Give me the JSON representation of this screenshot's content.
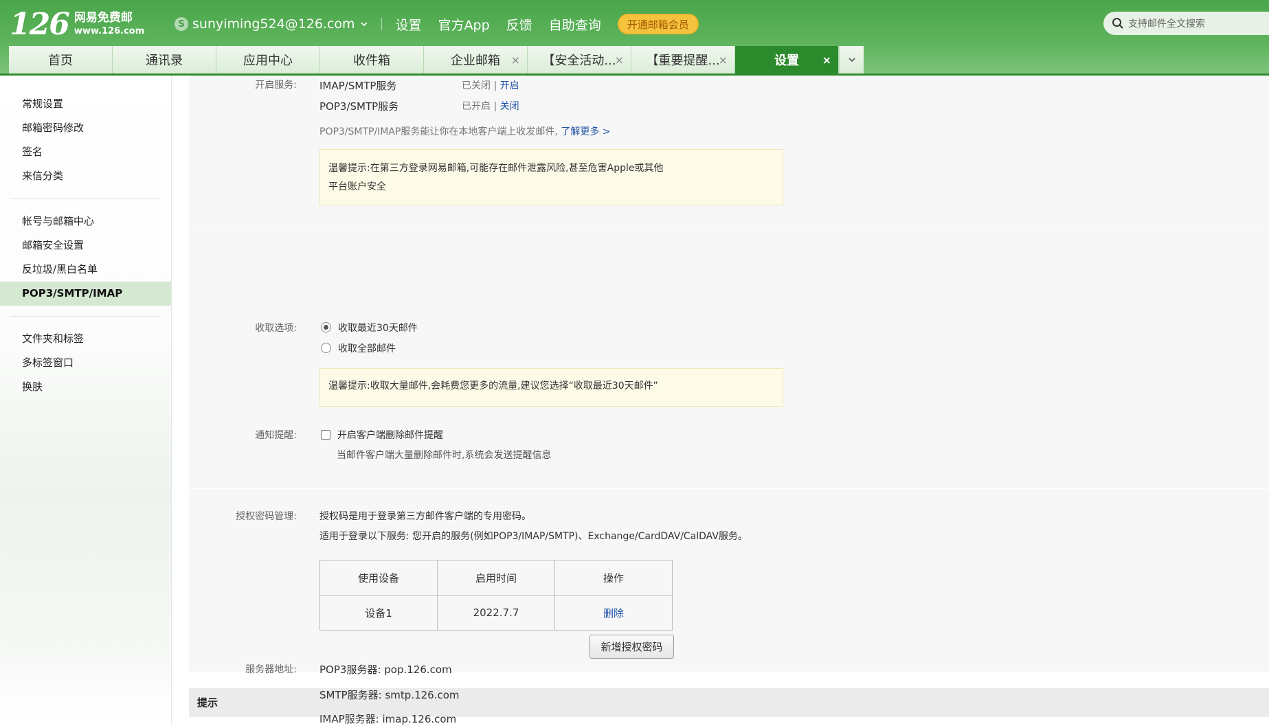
{
  "header": {
    "logo_number": "126",
    "logo_name": "网易免费邮",
    "logo_domain": "www.126.com",
    "account": "sunyiming524@126.com",
    "links": [
      "设置",
      "官方App",
      "反馈",
      "自助查询"
    ],
    "vip_label": "开通邮箱会员",
    "search_placeholder": "支持邮件全文搜索"
  },
  "tabs": [
    {
      "label": "首页",
      "closable": false
    },
    {
      "label": "通讯录",
      "closable": false
    },
    {
      "label": "应用中心",
      "closable": false
    },
    {
      "label": "收件箱",
      "closable": false
    },
    {
      "label": "企业邮箱",
      "closable": true
    },
    {
      "label": "【安全活动...",
      "closable": true
    },
    {
      "label": "【重要提醒...",
      "closable": true
    },
    {
      "label": "设置",
      "closable": true,
      "active": true
    }
  ],
  "sidebar": {
    "group1": [
      "常规设置",
      "邮箱密码修改",
      "签名",
      "来信分类"
    ],
    "group2": [
      "帐号与邮箱中心",
      "邮箱安全设置",
      "反垃圾/黑白名单",
      "POP3/SMTP/IMAP"
    ],
    "group3": [
      "文件夹和标签",
      "多标签窗口",
      "换肤"
    ],
    "active": "POP3/SMTP/IMAP"
  },
  "services": {
    "label": "开启服务:",
    "imap_name": "IMAP/SMTP服务",
    "imap_status": "已关闭",
    "imap_action": "开启",
    "pop_name": "POP3/SMTP服务",
    "pop_status": "已开启",
    "pop_action": "关闭",
    "separator": "|",
    "desc": "POP3/SMTP/IMAP服务能让你在本地客户端上收发邮件,",
    "learn_more": "了解更多 >",
    "tip_line1": "温馨提示:在第三方登录网易邮箱,可能存在邮件泄露风险,甚至危害Apple或其他",
    "tip_line2": "平台账户安全"
  },
  "receive": {
    "label": "收取选项:",
    "option1": "收取最近30天邮件",
    "option2": "收取全部邮件",
    "tip": "温馨提示:收取大量邮件,会耗费您更多的流量,建议您选择“收取最近30天邮件”"
  },
  "notify": {
    "label": "通知提醒:",
    "checkbox": "开启客户端删除邮件提醒",
    "desc": "当邮件客户端大量删除邮件时,系统会发送提醒信息"
  },
  "auth": {
    "label": "授权密码管理:",
    "line1": "授权码是用于登录第三方邮件客户端的专用密码。",
    "line2": "适用于登录以下服务: 您开启的服务(例如POP3/IMAP/SMTP)、Exchange/CardDAV/CalDAV服务。",
    "headers": [
      "使用设备",
      "启用时间",
      "操作"
    ],
    "rows": [
      {
        "device": "设备1",
        "time": "2022.7.7",
        "action": "删除"
      }
    ],
    "add_button": "新增授权密码"
  },
  "hint": {
    "title": "提示",
    "label": "服务器地址:",
    "pop": "POP3服务器: pop.126.com",
    "smtp": "SMTP服务器: smtp.126.com",
    "imap": "IMAP服务器: imap.126.com"
  },
  "colors": {
    "brand_green": "#4aa64a",
    "active_tab": "#2b8a2b",
    "vip": "#f5c23d",
    "link": "#1d4fa7"
  }
}
